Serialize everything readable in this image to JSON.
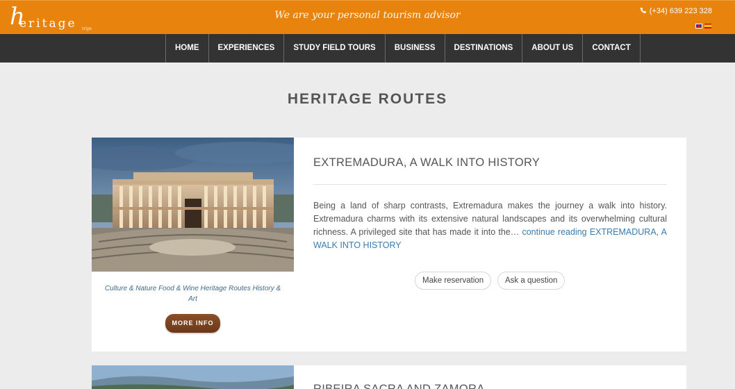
{
  "header": {
    "logo_letter": "h",
    "logo_rest": "eritage",
    "logo_sub": "trips",
    "tagline": "We are your personal tourism advisor",
    "phone": "(+34) 639 223 328",
    "languages": [
      "English",
      "Español"
    ]
  },
  "nav": {
    "items": [
      {
        "label": "HOME"
      },
      {
        "label": "EXPERIENCES"
      },
      {
        "label": "STUDY FIELD TOURS"
      },
      {
        "label": "BUSINESS"
      },
      {
        "label": "DESTINATIONS"
      },
      {
        "label": "ABOUT US"
      },
      {
        "label": "CONTACT"
      }
    ]
  },
  "page": {
    "title": "HERITAGE ROUTES"
  },
  "routes": [
    {
      "title": "EXTREMADURA, A WALK INTO HISTORY",
      "tags": "Culture & Nature  Food & Wine  Heritage Routes  History & Art",
      "more_info": "MORE INFO",
      "description": "Being a land of sharp contrasts, Extremadura makes the journey a walk into history. Extremadura charms with its extensive natural landscapes and its overwhelming cultural richness. A privileged site that has made it into the…",
      "continue_link": "continue reading EXTREMADURA, A WALK INTO HISTORY",
      "reservation_label": "Make reservation",
      "question_label": "Ask a question"
    },
    {
      "title": "RIBEIRA SACRA AND ZAMORA"
    }
  ],
  "colors": {
    "brand_orange": "#e8840e",
    "nav_dark": "#333333",
    "link_blue": "#3a7bb0",
    "button_brown": "#7a4420"
  }
}
